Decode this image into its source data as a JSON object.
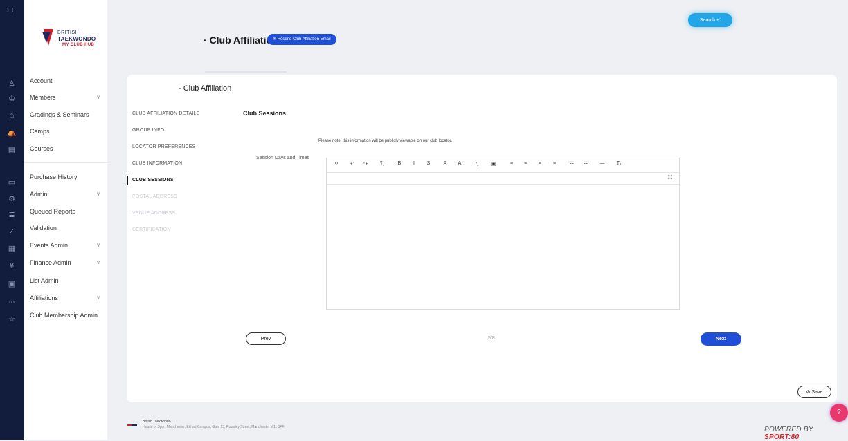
{
  "rail": {
    "toggle": "› ‹",
    "icons": [
      "user-icon",
      "users-icon",
      "graduation-icon",
      "tent-icon",
      "book-icon",
      "receipt-icon",
      "gear-icon",
      "stack-icon",
      "check-circle-icon",
      "calendar-icon",
      "coins-icon",
      "list-icon",
      "handshake-icon",
      "badge-icon"
    ]
  },
  "logo": {
    "line1": "BRITISH",
    "line2": "TAEKWONDO",
    "line3": "MY CLUB HUB"
  },
  "nav": {
    "items": [
      {
        "label": "Account"
      },
      {
        "label": "Members",
        "chevron": "∨"
      },
      {
        "label": "Gradings & Seminars"
      },
      {
        "label": "Camps"
      },
      {
        "label": "Courses"
      },
      {
        "label": "Purchase History"
      },
      {
        "label": "Admin",
        "chevron": "∨"
      },
      {
        "label": "Queued Reports"
      },
      {
        "label": "Validation"
      },
      {
        "label": "Events Admin",
        "chevron": "∨"
      },
      {
        "label": "Finance Admin",
        "chevron": "∨"
      },
      {
        "label": "List Admin"
      },
      {
        "label": "Affiliations",
        "chevron": "∨"
      },
      {
        "label": "Club Membership Admin"
      }
    ]
  },
  "header": {
    "title": "· Club Affiliation",
    "resend_label": "✉ Resend Club Affiliation Email",
    "search_label": "Search +⁚"
  },
  "card": {
    "title": "- Club Affiliation",
    "steps": [
      {
        "label": "CLUB AFFILIATION DETAILS",
        "state": "done"
      },
      {
        "label": "GROUP INFO",
        "state": "done"
      },
      {
        "label": "LOCATOR PREFERENCES",
        "state": "done"
      },
      {
        "label": "CLUB INFORMATION",
        "state": "done"
      },
      {
        "label": "CLUB SESSIONS",
        "state": "active"
      },
      {
        "label": "POSTAL ADDRESS",
        "state": "disabled"
      },
      {
        "label": "VENUE ADDRESS",
        "state": "disabled"
      },
      {
        "label": "CERTIFICATION",
        "state": "disabled"
      }
    ],
    "section_title": "Club Sessions",
    "note": "Please note: this information will be publicly viewable on our club locator.",
    "field_label": "Session Days and Times",
    "editor_value": "",
    "toolbar": [
      "‹›",
      "↶",
      "↷",
      "¶ˬ",
      "B",
      "I",
      "S",
      "A",
      "A",
      "ᐤˬ",
      "▣",
      "≡",
      "≡",
      "≡",
      "≡",
      "☷",
      "☷",
      "—",
      "Tₓ"
    ],
    "toolbar_names": [
      "code-view-icon",
      "undo-icon",
      "redo-icon",
      "paragraph-icon",
      "bold-icon",
      "italic-icon",
      "strikethrough-icon",
      "superscript-icon",
      "subscript-icon",
      "link-icon",
      "image-icon",
      "align-left-icon",
      "align-center-icon",
      "align-right-icon",
      "align-justify-icon",
      "ordered-list-icon",
      "unordered-list-icon",
      "horizontal-rule-icon",
      "clear-format-icon"
    ],
    "fullscreen": "⛶",
    "prev_label": "Prev",
    "counter": "5/8",
    "next_label": "Next",
    "save_label": "⊘ Save"
  },
  "footer": {
    "org": "British Taekwondo",
    "address": "House of Sport Manchester, Etihad Campus, Gate 13, Rowsley Street, Manchester M11 3FF.",
    "powered_prefix": "POWERED BY ",
    "powered_brand": "SPORT:80",
    "help_icon": "?"
  },
  "colors": {
    "rail_bg": "#121d3d",
    "accent_blue": "#1f4fd6",
    "search_blue": "#23a6e8",
    "brand_red": "#d21f2b"
  }
}
